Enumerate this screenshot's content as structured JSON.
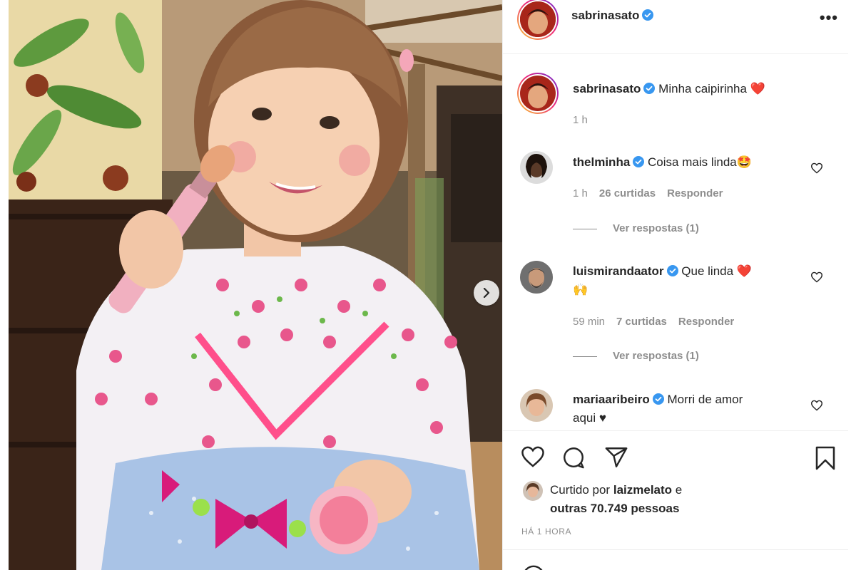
{
  "post": {
    "author": {
      "username": "sabrinasato",
      "verified": true
    },
    "caption": {
      "username": "sabrinasato",
      "text": "Minha caipirinha ❤️",
      "time": "1 h"
    },
    "more_label": "•••",
    "has_next_image": true
  },
  "comments": [
    {
      "username": "thelminha",
      "text": "Coisa mais linda🤩",
      "time": "1 h",
      "likes": "26 curtidas",
      "reply_label": "Responder",
      "view_replies": "Ver respostas (1)"
    },
    {
      "username": "luismirandaator",
      "text": "Que linda ❤️",
      "text_line2": "🙌",
      "time": "59 min",
      "likes": "7 curtidas",
      "reply_label": "Responder",
      "view_replies": "Ver respostas (1)"
    },
    {
      "username": "mariaaribeiro",
      "text": "Morri de amor",
      "text_line2": "aqui ♥"
    }
  ],
  "likes_summary": {
    "prefix": "Curtido por",
    "user": "laizmelato",
    "conjunction": "e",
    "others": "outras 70.749 pessoas"
  },
  "posted_ago": "HÁ 1 HORA",
  "icons": {
    "like": "heart-outline-icon",
    "comment": "speech-bubble-icon",
    "share": "paper-plane-icon",
    "save": "bookmark-icon",
    "verified": "verified-badge-icon",
    "next": "chevron-right-icon"
  },
  "colors": {
    "verified_blue": "#3897f0",
    "text_primary": "#262626",
    "text_secondary": "#8e8e8e",
    "divider": "#efefef"
  }
}
